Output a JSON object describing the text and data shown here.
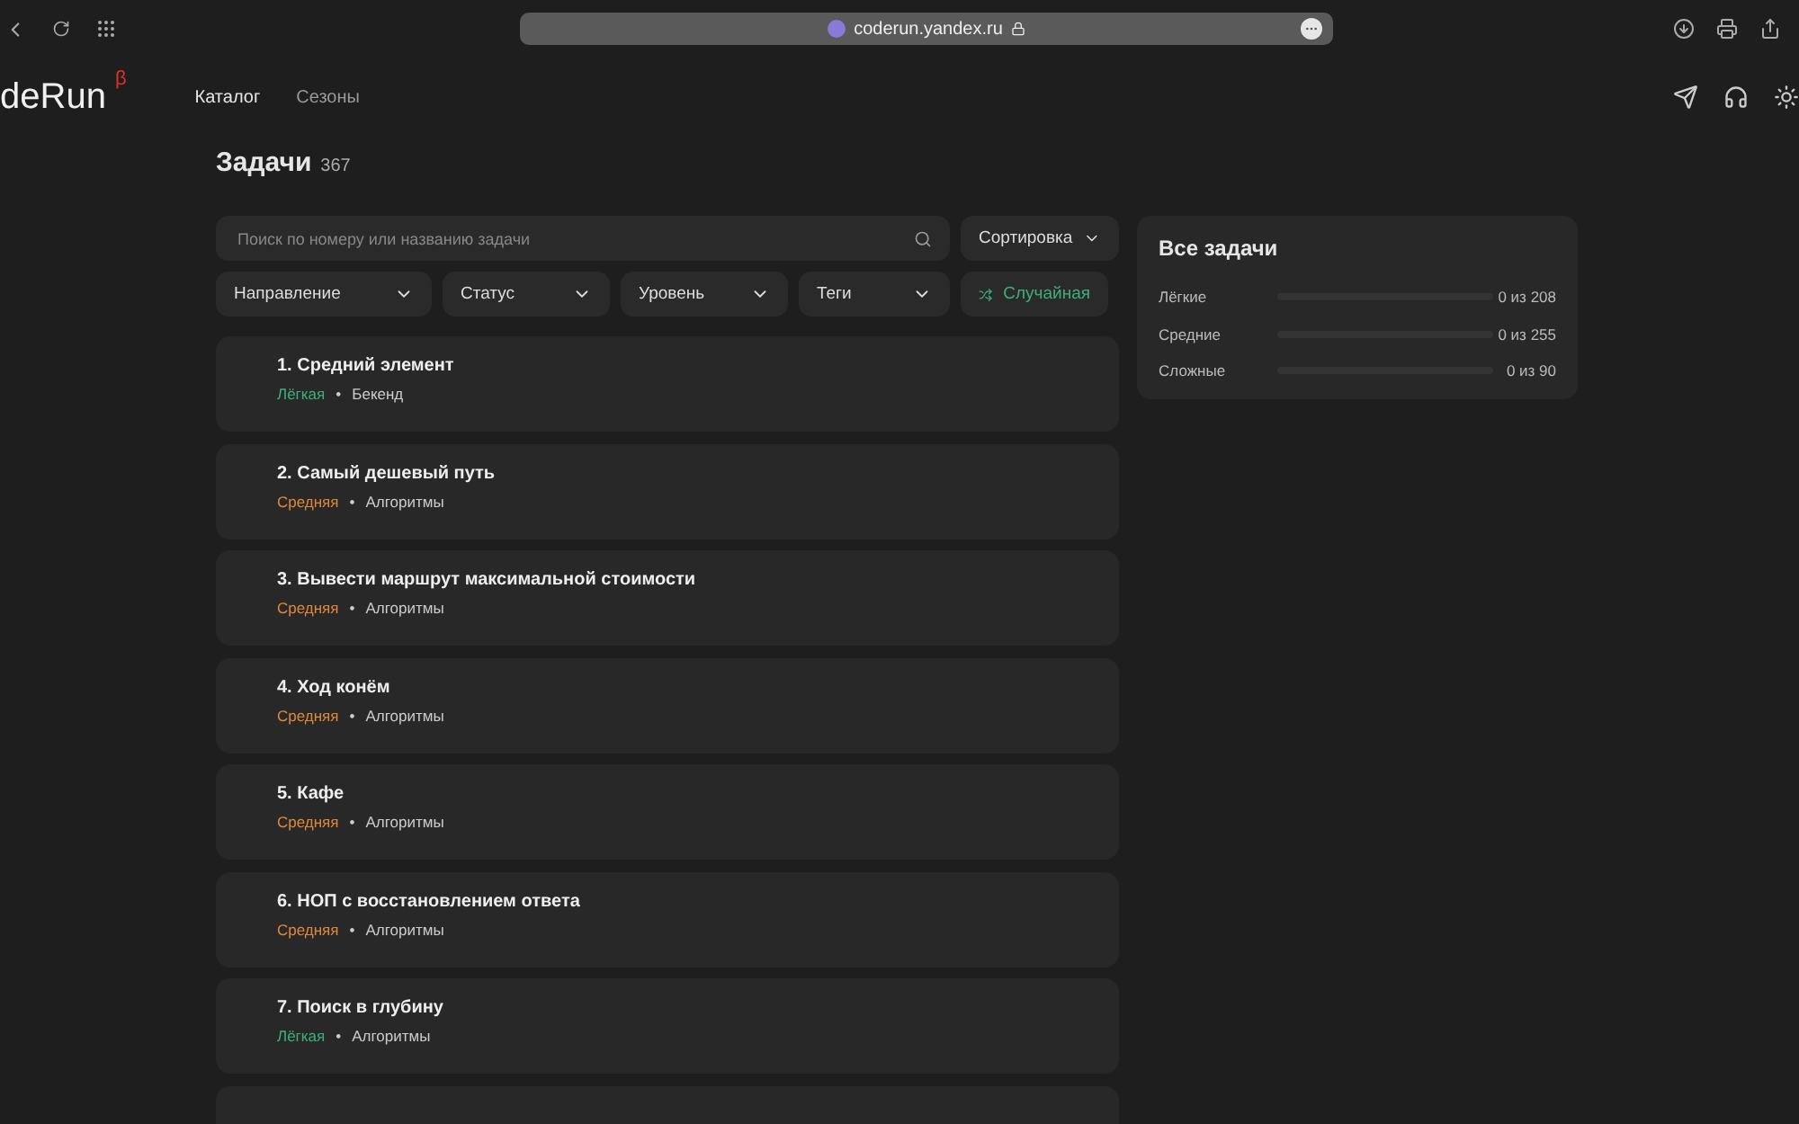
{
  "browser": {
    "url": "coderun.yandex.ru"
  },
  "header": {
    "logo": "deRun",
    "logo_mark": "β",
    "nav": [
      {
        "label": "Каталог",
        "selected": true
      },
      {
        "label": "Сезоны",
        "selected": false
      }
    ]
  },
  "page": {
    "title": "Задачи",
    "count": "367"
  },
  "search": {
    "placeholder": "Поиск по номеру или названию задачи"
  },
  "sort": {
    "label": "Сортировка"
  },
  "filters": [
    "Направление",
    "Статус",
    "Уровень",
    "Теги"
  ],
  "random": {
    "label": "Случайная"
  },
  "separator": "•",
  "tasks": [
    {
      "title": "1. Средний элемент",
      "level": "Лёгкая",
      "color": "#3fae7c",
      "tag": "Бекенд"
    },
    {
      "title": "2. Самый дешевый путь",
      "level": "Средняя",
      "color": "#e0883a",
      "tag": "Алгоритмы"
    },
    {
      "title": "3. Вывести маршрут максимальной стоимости",
      "level": "Средняя",
      "color": "#e0883a",
      "tag": "Алгоритмы"
    },
    {
      "title": "4. Ход конём",
      "level": "Средняя",
      "color": "#e0883a",
      "tag": "Алгоритмы"
    },
    {
      "title": "5. Кафе",
      "level": "Средняя",
      "color": "#e0883a",
      "tag": "Алгоритмы"
    },
    {
      "title": "6. НОП с восстановлением ответа",
      "level": "Средняя",
      "color": "#e0883a",
      "tag": "Алгоритмы"
    },
    {
      "title": "7. Поиск в глубину",
      "level": "Лёгкая",
      "color": "#3fae7c",
      "tag": "Алгоритмы"
    }
  ],
  "stats": {
    "title": "Все задачи",
    "rows": [
      {
        "label": "Лёгкие",
        "level": 0,
        "reading": "0 из 208"
      },
      {
        "label": "Средние",
        "level": 0,
        "reading": "0 из 255"
      },
      {
        "label": "Сложные",
        "level": 0,
        "reading": "0 из 90"
      }
    ]
  }
}
